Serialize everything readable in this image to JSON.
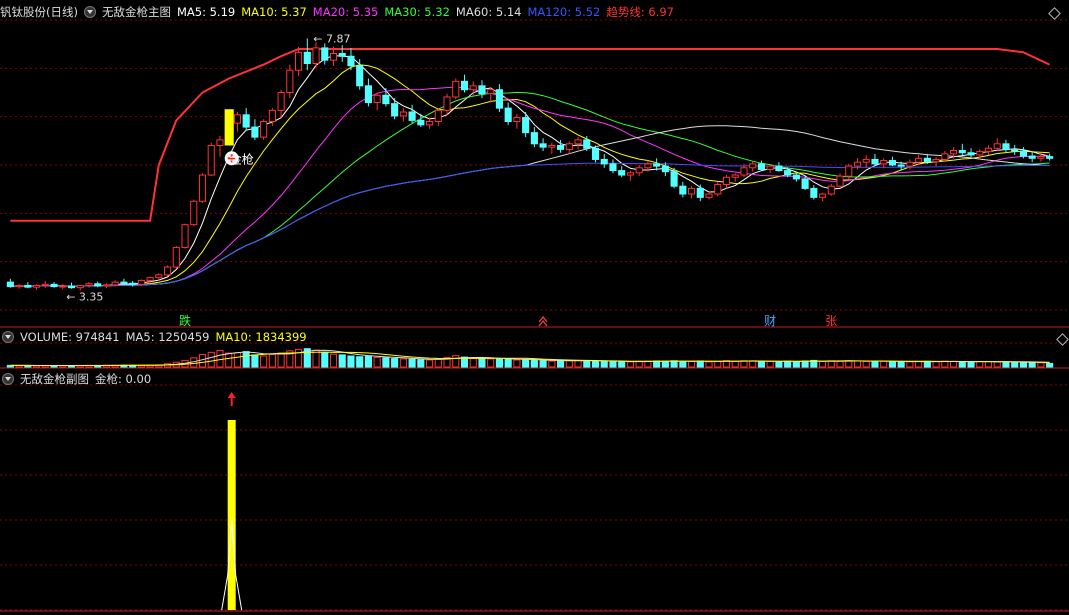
{
  "main_header": {
    "stock": "钒钛股份(日线)",
    "indicator": "无敌金枪主图",
    "items": [
      {
        "label": "MA5: 5.19",
        "color": "#ffffff"
      },
      {
        "label": "MA10: 5.37",
        "color": "#ffff00"
      },
      {
        "label": "MA20: 5.35",
        "color": "#ff33ff"
      },
      {
        "label": "MA30: 5.32",
        "color": "#33ff33"
      },
      {
        "label": "MA60: 5.14",
        "color": "#dddddd"
      },
      {
        "label": "MA120: 5.52",
        "color": "#3355ff"
      },
      {
        "label": "趋势线: 6.97",
        "color": "#ff3333"
      }
    ]
  },
  "volume_header": {
    "items": [
      {
        "label": "VOLUME: 974841",
        "color": "#dddddd"
      },
      {
        "label": "MA5: 1250459",
        "color": "#dddddd"
      },
      {
        "label": "MA10: 1834399",
        "color": "#ffff00"
      }
    ]
  },
  "sub_header": {
    "indicator": "无敌金枪副图",
    "value": "金枪: 0.00"
  },
  "annotations": {
    "high": "7.87",
    "low": "3.35",
    "signal": "金枪",
    "markers": [
      {
        "text": "跌",
        "color": "#33ff33"
      },
      {
        "text": "财",
        "color": "#44aaff"
      },
      {
        "text": "张",
        "color": "#ff3333"
      }
    ]
  },
  "colors": {
    "up": "#ff3232",
    "down": "#54ffff",
    "grid": "#8b0000",
    "signal_bar": "#ffff00"
  },
  "chart_data": [
    {
      "type": "candlestick",
      "title": "钒钛股份(日线)",
      "ylim": [
        3.0,
        8.2
      ],
      "ohlc": [
        [
          3.5,
          3.56,
          3.4,
          3.42
        ],
        [
          3.42,
          3.47,
          3.38,
          3.44
        ],
        [
          3.44,
          3.5,
          3.39,
          3.41
        ],
        [
          3.41,
          3.46,
          3.36,
          3.44
        ],
        [
          3.44,
          3.52,
          3.4,
          3.46
        ],
        [
          3.46,
          3.5,
          3.4,
          3.42
        ],
        [
          3.42,
          3.47,
          3.37,
          3.43
        ],
        [
          3.43,
          3.49,
          3.38,
          3.4
        ],
        [
          3.4,
          3.45,
          3.35,
          3.44
        ],
        [
          3.44,
          3.5,
          3.4,
          3.47
        ],
        [
          3.47,
          3.51,
          3.41,
          3.43
        ],
        [
          3.43,
          3.48,
          3.39,
          3.45
        ],
        [
          3.45,
          3.53,
          3.42,
          3.5
        ],
        [
          3.5,
          3.56,
          3.45,
          3.48
        ],
        [
          3.48,
          3.52,
          3.42,
          3.46
        ],
        [
          3.46,
          3.55,
          3.43,
          3.53
        ],
        [
          3.53,
          3.6,
          3.48,
          3.58
        ],
        [
          3.58,
          3.66,
          3.52,
          3.63
        ],
        [
          3.63,
          3.8,
          3.6,
          3.77
        ],
        [
          3.77,
          4.15,
          3.75,
          4.12
        ],
        [
          4.12,
          4.55,
          4.1,
          4.53
        ],
        [
          4.53,
          4.98,
          4.5,
          4.95
        ],
        [
          4.95,
          5.45,
          4.92,
          5.42
        ],
        [
          5.42,
          6.0,
          5.4,
          5.95
        ],
        [
          5.95,
          6.12,
          5.75,
          6.05
        ],
        [
          6.05,
          6.4,
          5.95,
          6.35
        ],
        [
          6.35,
          6.55,
          6.2,
          6.5
        ],
        [
          6.5,
          6.62,
          6.22,
          6.28
        ],
        [
          6.28,
          6.42,
          6.05,
          6.1
        ],
        [
          6.1,
          6.42,
          6.05,
          6.38
        ],
        [
          6.38,
          6.62,
          6.3,
          6.58
        ],
        [
          6.58,
          6.95,
          6.45,
          6.9
        ],
        [
          6.9,
          7.4,
          6.8,
          7.3
        ],
        [
          7.3,
          7.72,
          7.2,
          7.62
        ],
        [
          7.62,
          7.87,
          7.3,
          7.42
        ],
        [
          7.42,
          7.8,
          7.35,
          7.7
        ],
        [
          7.7,
          7.78,
          7.4,
          7.48
        ],
        [
          7.48,
          7.72,
          7.38,
          7.6
        ],
        [
          7.6,
          7.75,
          7.45,
          7.55
        ],
        [
          7.55,
          7.7,
          7.3,
          7.38
        ],
        [
          7.38,
          7.5,
          6.95,
          7.02
        ],
        [
          7.02,
          7.15,
          6.65,
          6.72
        ],
        [
          6.72,
          6.9,
          6.58,
          6.85
        ],
        [
          6.85,
          6.98,
          6.65,
          6.7
        ],
        [
          6.7,
          6.8,
          6.42,
          6.48
        ],
        [
          6.48,
          6.62,
          6.38,
          6.55
        ],
        [
          6.55,
          6.68,
          6.35,
          6.4
        ],
        [
          6.4,
          6.52,
          6.28,
          6.32
        ],
        [
          6.32,
          6.45,
          6.25,
          6.38
        ],
        [
          6.38,
          6.62,
          6.3,
          6.58
        ],
        [
          6.58,
          6.88,
          6.5,
          6.82
        ],
        [
          6.82,
          7.15,
          6.78,
          7.1
        ],
        [
          7.1,
          7.22,
          6.9,
          6.95
        ],
        [
          6.95,
          7.1,
          6.85,
          7.02
        ],
        [
          7.02,
          7.12,
          6.8,
          6.88
        ],
        [
          6.88,
          7.0,
          6.72,
          6.95
        ],
        [
          6.95,
          7.05,
          6.55,
          6.62
        ],
        [
          6.62,
          6.72,
          6.32,
          6.38
        ],
        [
          6.38,
          6.52,
          6.25,
          6.45
        ],
        [
          6.45,
          6.55,
          6.1,
          6.18
        ],
        [
          6.18,
          6.28,
          5.92,
          5.98
        ],
        [
          5.98,
          6.08,
          5.85,
          5.92
        ],
        [
          5.92,
          6.0,
          5.8,
          5.95
        ],
        [
          5.95,
          6.05,
          5.82,
          5.88
        ],
        [
          5.88,
          6.02,
          5.8,
          5.98
        ],
        [
          5.98,
          6.1,
          5.88,
          6.05
        ],
        [
          6.05,
          6.12,
          5.85,
          5.9
        ],
        [
          5.9,
          5.95,
          5.65,
          5.7
        ],
        [
          5.7,
          5.8,
          5.55,
          5.62
        ],
        [
          5.62,
          5.7,
          5.45,
          5.5
        ],
        [
          5.5,
          5.58,
          5.38,
          5.42
        ],
        [
          5.42,
          5.5,
          5.32,
          5.46
        ],
        [
          5.46,
          5.6,
          5.4,
          5.55
        ],
        [
          5.55,
          5.68,
          5.48,
          5.62
        ],
        [
          5.62,
          5.72,
          5.5,
          5.58
        ],
        [
          5.58,
          5.65,
          5.4,
          5.48
        ],
        [
          5.48,
          5.55,
          5.18,
          5.22
        ],
        [
          5.22,
          5.3,
          5.02,
          5.08
        ],
        [
          5.08,
          5.22,
          5.0,
          5.18
        ],
        [
          5.18,
          5.25,
          4.95,
          5.02
        ],
        [
          5.02,
          5.12,
          4.98,
          5.08
        ],
        [
          5.08,
          5.3,
          5.04,
          5.25
        ],
        [
          5.25,
          5.42,
          5.18,
          5.38
        ],
        [
          5.38,
          5.45,
          5.3,
          5.42
        ],
        [
          5.42,
          5.62,
          5.38,
          5.55
        ],
        [
          5.55,
          5.66,
          5.48,
          5.62
        ],
        [
          5.62,
          5.68,
          5.5,
          5.52
        ],
        [
          5.52,
          5.6,
          5.46,
          5.58
        ],
        [
          5.58,
          5.65,
          5.48,
          5.5
        ],
        [
          5.5,
          5.56,
          5.38,
          5.42
        ],
        [
          5.42,
          5.48,
          5.3,
          5.35
        ],
        [
          5.35,
          5.4,
          5.15,
          5.18
        ],
        [
          5.18,
          5.24,
          4.98,
          5.02
        ],
        [
          5.02,
          5.1,
          4.95,
          5.08
        ],
        [
          5.08,
          5.26,
          5.05,
          5.22
        ],
        [
          5.22,
          5.45,
          5.2,
          5.4
        ],
        [
          5.4,
          5.62,
          5.35,
          5.58
        ],
        [
          5.58,
          5.72,
          5.52,
          5.65
        ],
        [
          5.65,
          5.78,
          5.55,
          5.7
        ],
        [
          5.7,
          5.8,
          5.6,
          5.62
        ],
        [
          5.62,
          5.72,
          5.54,
          5.68
        ],
        [
          5.68,
          5.75,
          5.58,
          5.6
        ],
        [
          5.6,
          5.66,
          5.5,
          5.58
        ],
        [
          5.58,
          5.7,
          5.52,
          5.65
        ],
        [
          5.65,
          5.78,
          5.6,
          5.72
        ],
        [
          5.72,
          5.8,
          5.62,
          5.66
        ],
        [
          5.66,
          5.74,
          5.58,
          5.7
        ],
        [
          5.7,
          5.85,
          5.65,
          5.8
        ],
        [
          5.8,
          5.92,
          5.72,
          5.86
        ],
        [
          5.86,
          5.98,
          5.78,
          5.82
        ],
        [
          5.82,
          5.9,
          5.74,
          5.78
        ],
        [
          5.78,
          5.88,
          5.7,
          5.84
        ],
        [
          5.84,
          5.95,
          5.78,
          5.9
        ],
        [
          5.9,
          6.08,
          5.85,
          5.98
        ],
        [
          5.98,
          6.05,
          5.82,
          5.88
        ],
        [
          5.88,
          5.96,
          5.78,
          5.85
        ],
        [
          5.85,
          5.92,
          5.72,
          5.76
        ],
        [
          5.76,
          5.84,
          5.65,
          5.72
        ],
        [
          5.72,
          5.82,
          5.66,
          5.75
        ],
        [
          5.75,
          5.8,
          5.68,
          5.72
        ]
      ],
      "ma_series": [
        {
          "name": "MA5",
          "period": 5,
          "color": "#ffffff"
        },
        {
          "name": "MA10",
          "period": 10,
          "color": "#ffff00"
        },
        {
          "name": "MA20",
          "period": 20,
          "color": "#ff33ff"
        },
        {
          "name": "MA30",
          "period": 30,
          "color": "#33ff33"
        },
        {
          "name": "MA60",
          "period": 60,
          "color": "#dddddd"
        },
        {
          "name": "MA120",
          "period": 120,
          "color": "#3355ff"
        }
      ],
      "trend_line": {
        "name": "趋势线",
        "color": "#ff3333",
        "points": [
          [
            0,
            4.6
          ],
          [
            16,
            4.6
          ],
          [
            17,
            5.6
          ],
          [
            19,
            6.4
          ],
          [
            22,
            6.9
          ],
          [
            25,
            7.15
          ],
          [
            29,
            7.4
          ],
          [
            31,
            7.55
          ],
          [
            33,
            7.68
          ],
          [
            113,
            7.68
          ],
          [
            116,
            7.62
          ],
          [
            119,
            7.4
          ]
        ]
      },
      "signal_index": 25
    },
    {
      "type": "bar",
      "title": "VOLUME",
      "ylim": [
        0,
        6000000
      ],
      "values": [
        450000,
        420000,
        400000,
        380000,
        390000,
        410000,
        400000,
        380000,
        420000,
        450000,
        430000,
        460000,
        480000,
        500000,
        470000,
        520000,
        550000,
        600000,
        900000,
        1300000,
        1800000,
        2500000,
        3400000,
        4000000,
        4500000,
        3800000,
        3900000,
        4200000,
        3300000,
        3000000,
        3400000,
        3800000,
        4400000,
        4800000,
        5000000,
        4600000,
        4000000,
        3500000,
        3300000,
        3000000,
        2800000,
        2900000,
        2600000,
        2500000,
        2300000,
        2200000,
        2100000,
        2000000,
        1900000,
        2200000,
        2600000,
        3100000,
        2700000,
        2400000,
        2300000,
        2200000,
        2300000,
        2100000,
        1900000,
        2000000,
        1900000,
        1700000,
        1600000,
        1650000,
        1700000,
        1800000,
        1750000,
        1600000,
        1500000,
        1450000,
        1500000,
        1400000,
        1550000,
        1600000,
        1650000,
        1600000,
        1700000,
        1550000,
        1500000,
        1650000,
        1400000,
        1550000,
        1750000,
        1600000,
        1700000,
        1650000,
        1500000,
        1550000,
        1450000,
        1600000,
        1500000,
        1650000,
        1800000,
        1550000,
        1700000,
        1600000,
        1750000,
        1650000,
        1500000,
        1600000,
        1550000,
        1500000,
        1450000,
        1400000,
        1500000,
        1550000,
        1450000,
        1600000,
        1500000,
        1450000,
        1400000,
        1500000,
        1450000,
        1350000,
        1400000,
        1300000,
        1250000,
        1200000,
        1150000,
        974841
      ]
    },
    {
      "type": "bar",
      "title": "无敌金枪副图",
      "series": [
        {
          "name": "金枪",
          "signal_index": 25,
          "value": 1
        }
      ],
      "current": 0.0
    }
  ]
}
